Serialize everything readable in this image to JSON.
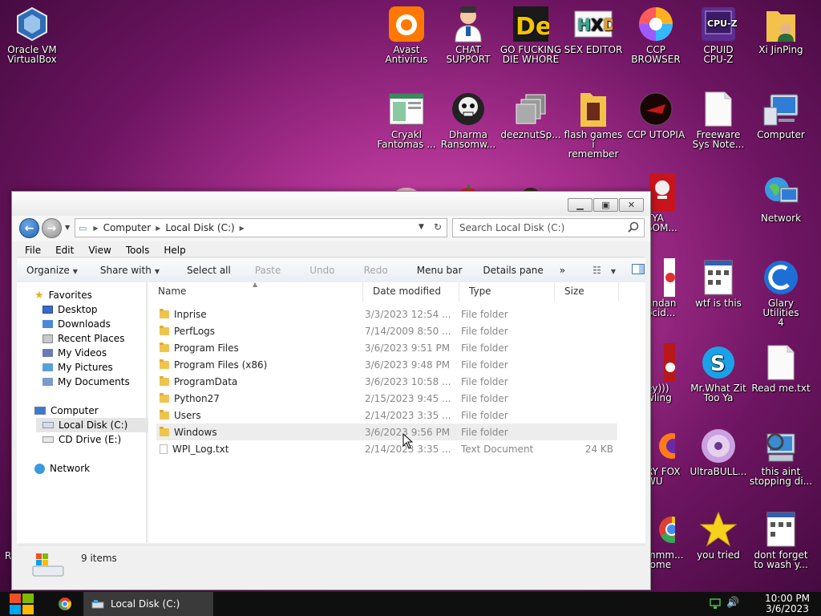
{
  "desktop": {
    "icons": [
      {
        "name": "virtualbox-icon",
        "label": "Oracle VM\nVirtualBox"
      },
      {
        "name": "avast-icon",
        "label": "Avast\nAntivirus"
      },
      {
        "name": "chat-support-icon",
        "label": "CHAT\nSUPPORT"
      },
      {
        "name": "die-whore-icon",
        "label": "GO FUCKING\nDIE WHORE"
      },
      {
        "name": "sex-editor-icon",
        "label": "SEX EDITOR"
      },
      {
        "name": "ccp-browser-icon",
        "label": "CCP\nBROWSER"
      },
      {
        "name": "cpuz-icon",
        "label": "CPUID\nCPU-Z"
      },
      {
        "name": "xi-jinping-icon",
        "label": "Xi JinPing"
      },
      {
        "name": "cryakl-icon",
        "label": "Cryakl\nFantomas ..."
      },
      {
        "name": "dharma-icon",
        "label": "Dharma\nRansomw..."
      },
      {
        "name": "deeznut-icon",
        "label": "deeznutSp..."
      },
      {
        "name": "flash-games-icon",
        "label": "flash games i\nremember"
      },
      {
        "name": "ccp-utopia-icon",
        "label": "CCP UTOPIA"
      },
      {
        "name": "freeware-icon",
        "label": "Freeware\nSys Note..."
      },
      {
        "name": "computer-icon",
        "label": "Computer"
      },
      {
        "name": "tya-icon",
        "label": "TYA\nSOM..."
      },
      {
        "name": "network-icon",
        "label": "Network"
      },
      {
        "name": "andan-icon",
        "label": "andan\nocid..."
      },
      {
        "name": "wtf-icon",
        "label": "wtf is this"
      },
      {
        "name": "glary-icon",
        "label": "Glary Utilities\n4"
      },
      {
        "name": "ey-icon",
        "label": "ey)))\nwling"
      },
      {
        "name": "skype-icon",
        "label": "Mr.What Zit\nToo Ya"
      },
      {
        "name": "readme-icon",
        "label": "Read me.txt"
      },
      {
        "name": "fox-icon",
        "label": "RY FOX\nWU"
      },
      {
        "name": "ultrabull-icon",
        "label": "UltraBULL..."
      },
      {
        "name": "stopping-icon",
        "label": "this aint\nstopping di..."
      },
      {
        "name": "chrome-desk-icon",
        "label": "mmm...\nrome"
      },
      {
        "name": "star-icon",
        "label": "you tried"
      },
      {
        "name": "wash-icon",
        "label": "dont forget\nto wash y..."
      },
      {
        "name": "r-partial-icon",
        "label": "R"
      }
    ]
  },
  "explorer": {
    "address": {
      "crumbs": [
        "Computer",
        "Local Disk (C:)"
      ]
    },
    "search": {
      "placeholder": "Search Local Disk (C:)"
    },
    "menu": [
      "File",
      "Edit",
      "View",
      "Tools",
      "Help"
    ],
    "toolbar": {
      "organize": "Organize",
      "share": "Share with",
      "select_all": "Select all",
      "paste": "Paste",
      "undo": "Undo",
      "redo": "Redo",
      "menu_bar": "Menu bar",
      "details_pane": "Details pane",
      "more": "»"
    },
    "nav": {
      "favorites": "Favorites",
      "desktop": "Desktop",
      "downloads": "Downloads",
      "recent": "Recent Places",
      "videos": "My Videos",
      "pictures": "My Pictures",
      "documents": "My Documents",
      "computer": "Computer",
      "local_disk": "Local Disk (C:)",
      "cd_drive": "CD Drive (E:)",
      "network": "Network"
    },
    "columns": {
      "name": "Name",
      "date": "Date modified",
      "type": "Type",
      "size": "Size"
    },
    "files": [
      {
        "name": "Inprise",
        "date": "3/3/2023 12:54 ...",
        "type": "File folder",
        "size": ""
      },
      {
        "name": "PerfLogs",
        "date": "7/14/2009 8:50 ...",
        "type": "File folder",
        "size": ""
      },
      {
        "name": "Program Files",
        "date": "3/6/2023 9:51 PM",
        "type": "File folder",
        "size": ""
      },
      {
        "name": "Program Files (x86)",
        "date": "3/6/2023 9:48 PM",
        "type": "File folder",
        "size": ""
      },
      {
        "name": "ProgramData",
        "date": "3/6/2023 10:58 ...",
        "type": "File folder",
        "size": ""
      },
      {
        "name": "Python27",
        "date": "2/15/2023 9:45 ...",
        "type": "File folder",
        "size": ""
      },
      {
        "name": "Users",
        "date": "2/14/2023 3:35 ...",
        "type": "File folder",
        "size": ""
      },
      {
        "name": "Windows",
        "date": "3/6/2023 9:56 PM",
        "type": "File folder",
        "size": ""
      },
      {
        "name": "WPI_Log.txt",
        "date": "2/14/2023 3:35 ...",
        "type": "Text Document",
        "size": "24 KB"
      }
    ],
    "status": {
      "count": "9 items"
    }
  },
  "taskbar": {
    "active_window": "Local Disk (C:)",
    "time": "10:00 PM",
    "date": "3/6/2023"
  }
}
